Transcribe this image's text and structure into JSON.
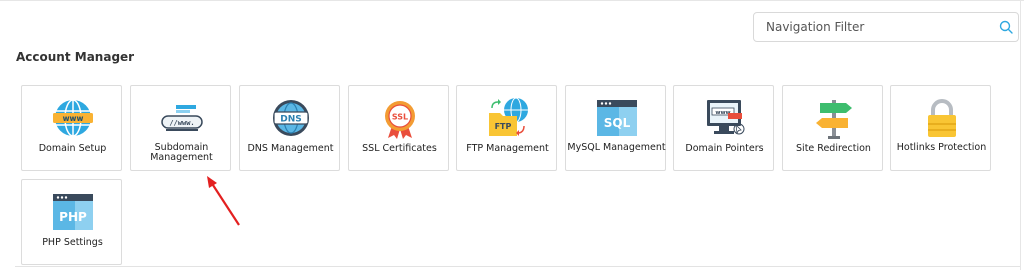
{
  "search": {
    "placeholder": "Navigation Filter"
  },
  "section": {
    "title": "Account Manager"
  },
  "tiles": [
    {
      "label": "Domain Setup",
      "icon": "globe-www-icon"
    },
    {
      "label": "Subdomain Management",
      "icon": "subdomain-www-bar-icon"
    },
    {
      "label": "DNS Management",
      "icon": "dns-globe-icon"
    },
    {
      "label": "SSL Certificates",
      "icon": "ssl-badge-icon"
    },
    {
      "label": "FTP Management",
      "icon": "ftp-folder-globe-icon"
    },
    {
      "label": "MySQL Management",
      "icon": "sql-database-icon"
    },
    {
      "label": "Domain Pointers",
      "icon": "monitor-www-icon"
    },
    {
      "label": "Site Redirection",
      "icon": "signpost-icon"
    },
    {
      "label": "Hotlinks Protection",
      "icon": "padlock-icon"
    },
    {
      "label": "PHP Settings",
      "icon": "php-window-icon"
    }
  ],
  "colors": {
    "accent": "#2ea8e0",
    "annotation_arrow": "#e32020"
  }
}
